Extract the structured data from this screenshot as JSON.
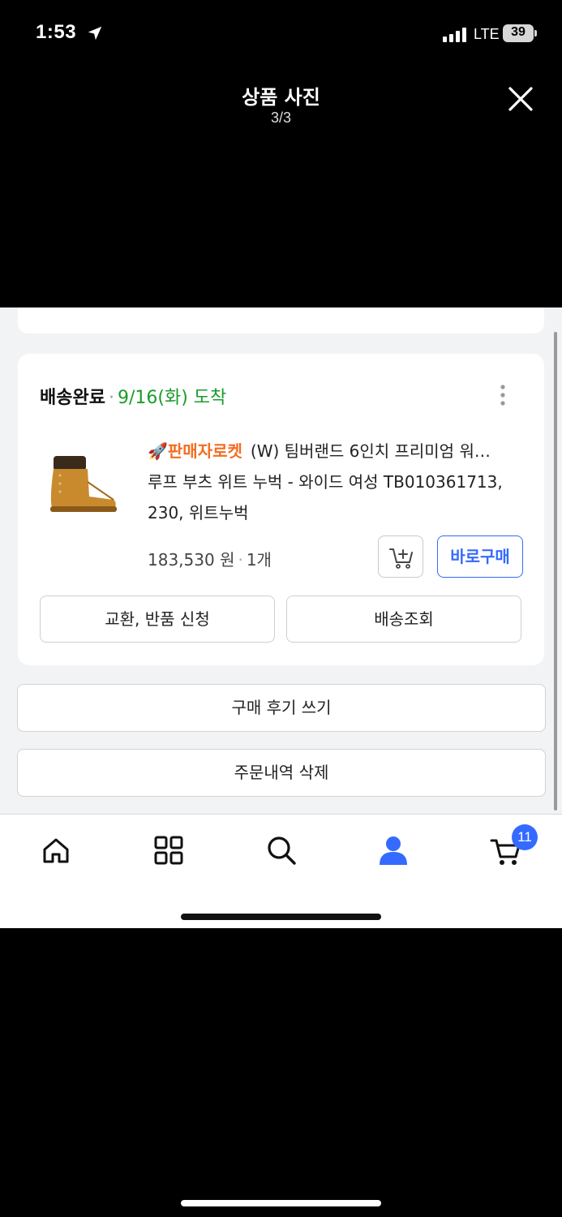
{
  "status_bar": {
    "time": "1:53",
    "network": "LTE",
    "battery": "39"
  },
  "viewer": {
    "title": "상품 사진",
    "counter": "3/3"
  },
  "order": {
    "status": "배송완료",
    "arrival": "9/16(화) 도착",
    "product": {
      "badge": "🚀판매자로켓",
      "name_line1": "(W) 팀버랜드 6인치 프리미엄 워…",
      "name_line2": "루프 부츠 위트 누벅 - 와이드 여성 TB010361713,",
      "name_line3": "230, 위트누벅",
      "price": "183,530 원",
      "quantity": "1개"
    },
    "buy_now_label": "바로구매",
    "exchange_return_label": "교환, 반품 신청",
    "track_delivery_label": "배송조회"
  },
  "actions": {
    "write_review": "구매 후기 쓰기",
    "delete_order": "주문내역 삭제"
  },
  "bottom_nav": {
    "cart_count": "11",
    "active": "my-page"
  },
  "colors": {
    "accent": "#346aff",
    "delivered_green": "#1b9c2b",
    "rocket_orange": "#f36c21"
  }
}
